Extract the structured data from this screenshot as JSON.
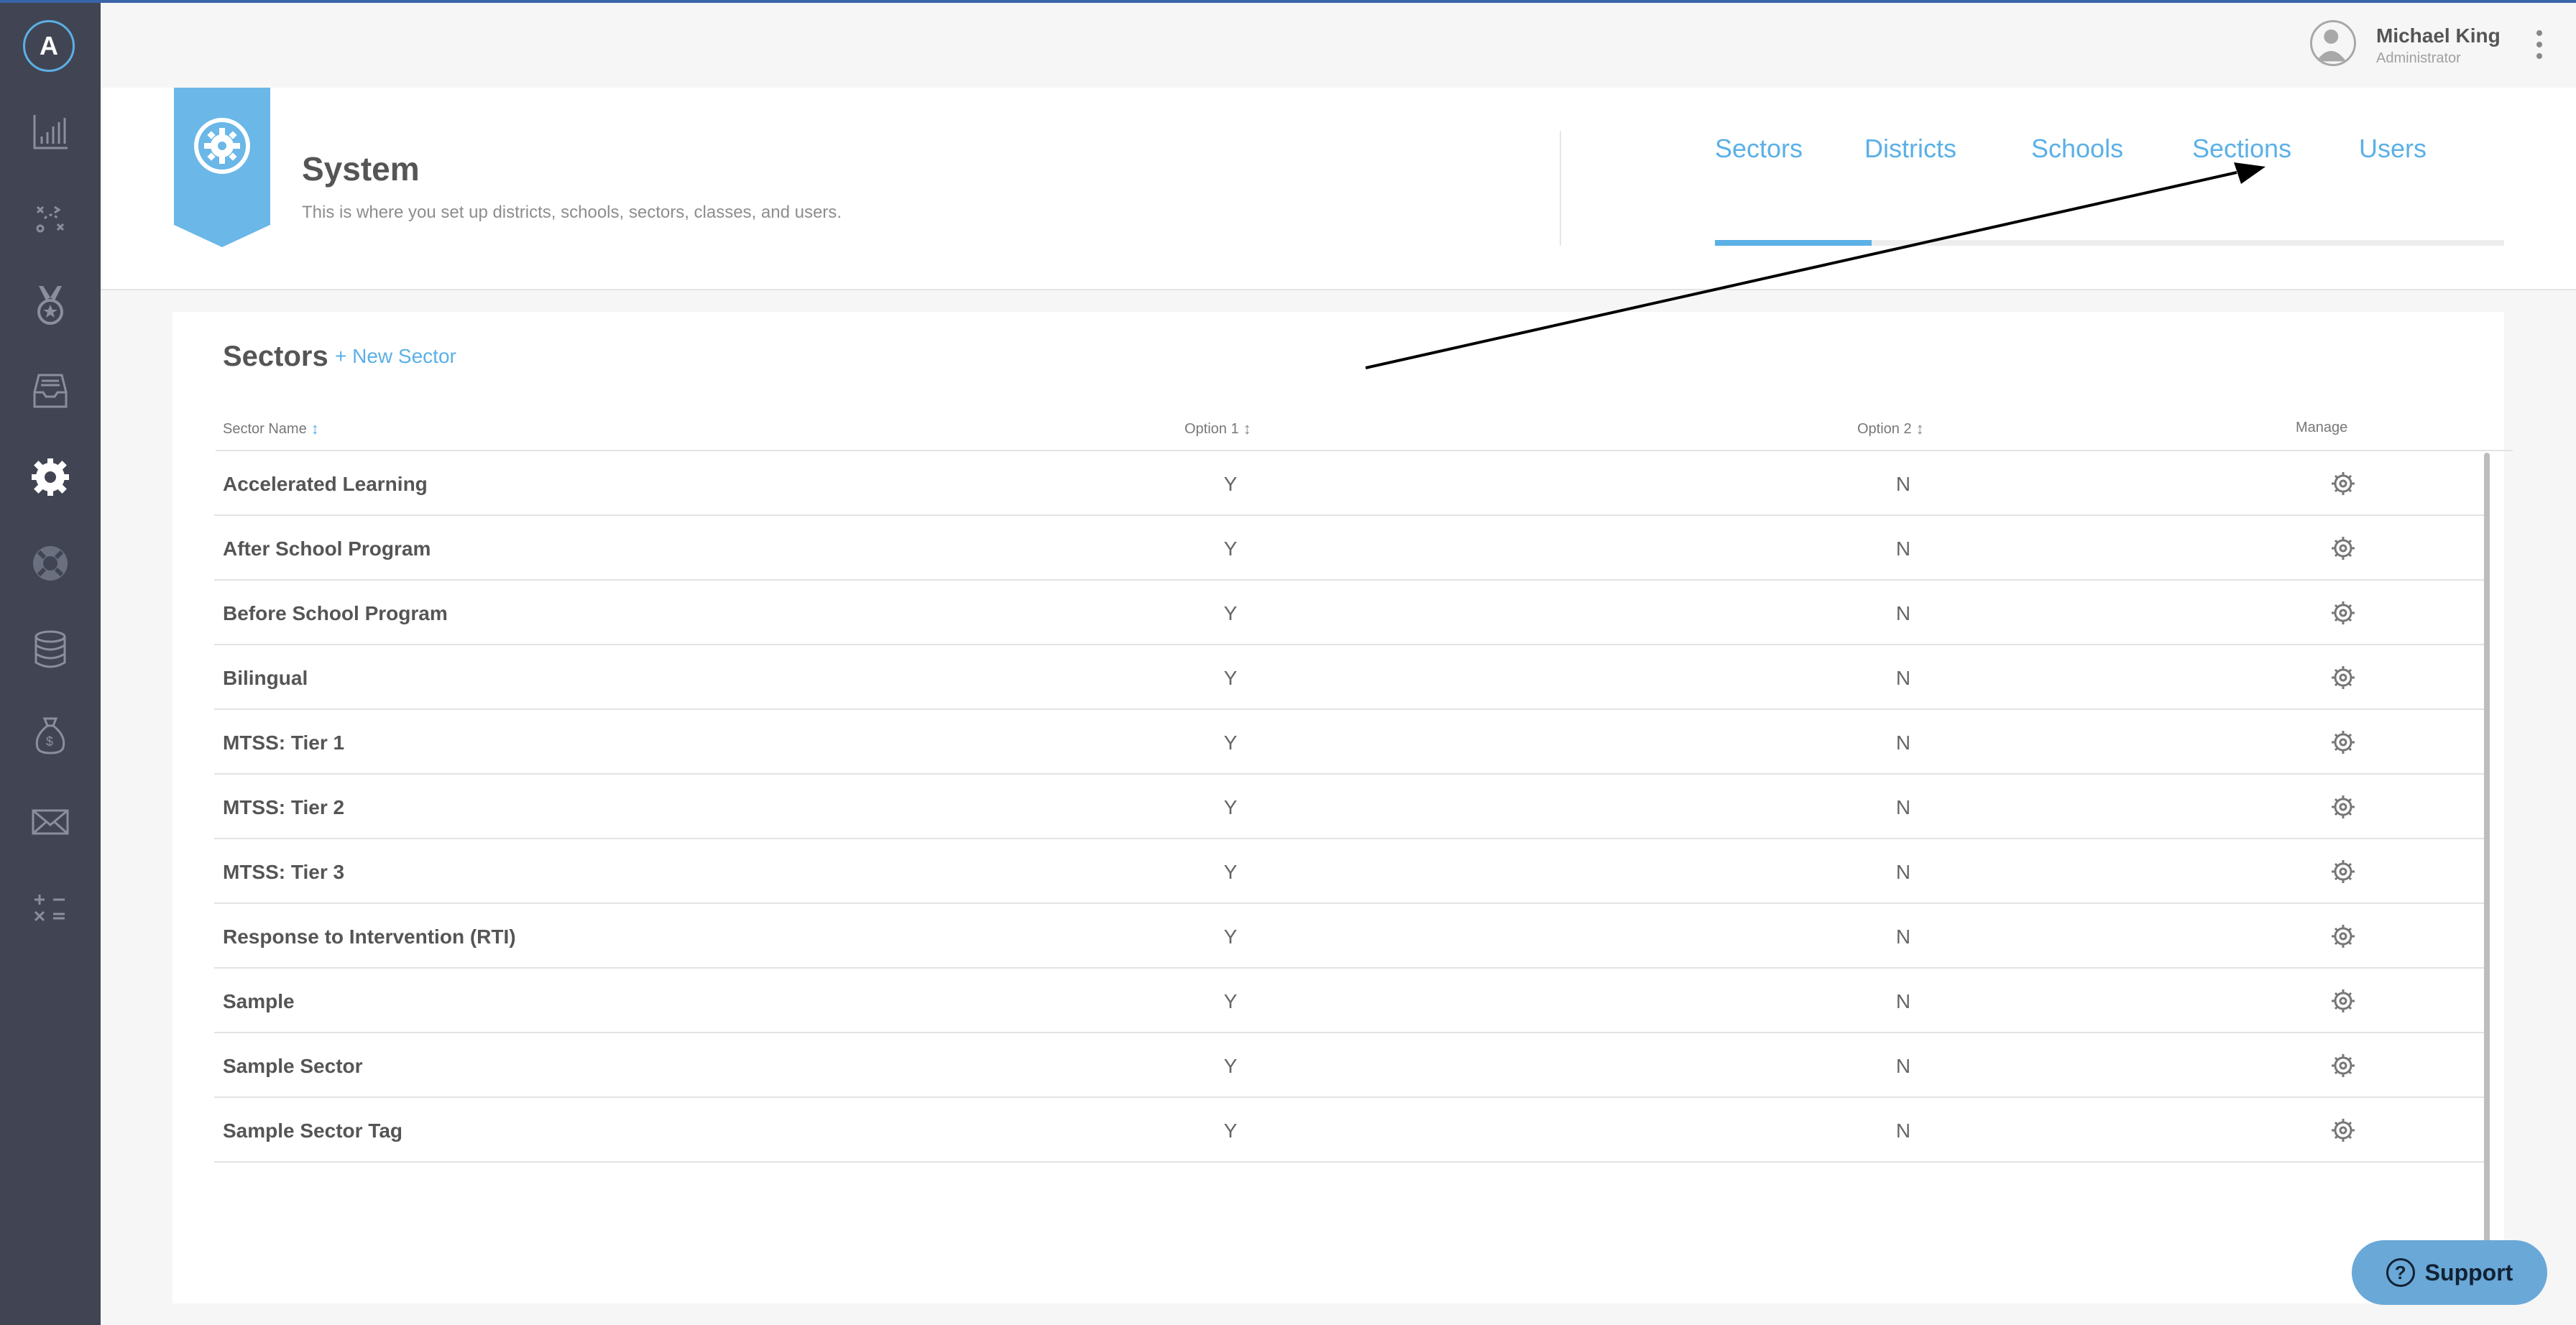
{
  "colors": {
    "accent": "#5bb0e6",
    "sidebar_bg": "#414553",
    "ribbon": "#6ab7e8",
    "support_bg": "#6aa8d8"
  },
  "sidebar": {
    "logo_letter": "A",
    "items": [
      {
        "icon": "bar-chart-icon"
      },
      {
        "icon": "strategy-icon"
      },
      {
        "icon": "medal-icon"
      },
      {
        "icon": "inbox-tray-icon"
      },
      {
        "icon": "system-gear-icon",
        "active": true
      },
      {
        "icon": "lifebuoy-icon"
      },
      {
        "icon": "database-icon"
      },
      {
        "icon": "money-bag-icon"
      },
      {
        "icon": "envelope-icon"
      },
      {
        "icon": "calculator-icon"
      }
    ]
  },
  "user": {
    "name": "Michael King",
    "role": "Administrator"
  },
  "header": {
    "title": "System",
    "subtitle": "This is where you set up districts, schools, sectors, classes, and users.",
    "tabs": [
      {
        "label": "Sectors",
        "active": true
      },
      {
        "label": "Districts"
      },
      {
        "label": "Schools"
      },
      {
        "label": "Sections"
      },
      {
        "label": "Users"
      }
    ]
  },
  "sectors": {
    "title": "Sectors",
    "new_label": "+ New Sector",
    "columns": {
      "name": "Sector Name",
      "option1": "Option 1",
      "option2": "Option 2",
      "manage": "Manage"
    },
    "rows": [
      {
        "name": "Accelerated Learning",
        "option1": "Y",
        "option2": "N"
      },
      {
        "name": "After School Program",
        "option1": "Y",
        "option2": "N"
      },
      {
        "name": "Before School Program",
        "option1": "Y",
        "option2": "N"
      },
      {
        "name": "Bilingual",
        "option1": "Y",
        "option2": "N"
      },
      {
        "name": "MTSS: Tier 1",
        "option1": "Y",
        "option2": "N"
      },
      {
        "name": "MTSS: Tier 2",
        "option1": "Y",
        "option2": "N"
      },
      {
        "name": "MTSS: Tier 3",
        "option1": "Y",
        "option2": "N"
      },
      {
        "name": "Response to Intervention (RTI)",
        "option1": "Y",
        "option2": "N"
      },
      {
        "name": "Sample",
        "option1": "Y",
        "option2": "N"
      },
      {
        "name": "Sample Sector",
        "option1": "Y",
        "option2": "N"
      },
      {
        "name": "Sample Sector Tag",
        "option1": "Y",
        "option2": "N"
      }
    ]
  },
  "support": {
    "label": "Support"
  }
}
